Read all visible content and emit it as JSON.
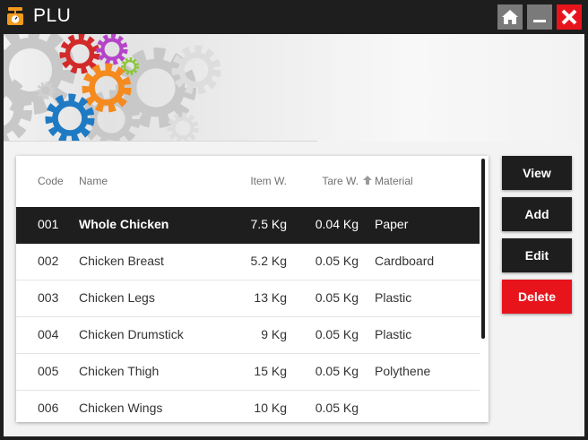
{
  "window": {
    "title": "PLU"
  },
  "colors": {
    "titlebar": "#1e1e1e",
    "accent_red": "#e8141c",
    "button_dark": "#1e1e1e",
    "titlebar_button_gray": "#7a7a7a",
    "selected_row": "#1e1e1e"
  },
  "icons": {
    "app": "scale-icon",
    "home": "home-icon",
    "minimize": "minimize-icon",
    "close": "close-icon"
  },
  "table": {
    "headers": {
      "code": "Code",
      "name": "Name",
      "item_weight": "Item W.",
      "tare_weight": "Tare W.",
      "material": "Material"
    },
    "selected_index": 0,
    "rows": [
      {
        "code": "001",
        "name": "Whole Chicken",
        "item_weight": "7.5 Kg",
        "tare_weight": "0.04 Kg",
        "material": "Paper"
      },
      {
        "code": "002",
        "name": "Chicken Breast",
        "item_weight": "5.2 Kg",
        "tare_weight": "0.05 Kg",
        "material": "Cardboard"
      },
      {
        "code": "003",
        "name": "Chicken Legs",
        "item_weight": "13 Kg",
        "tare_weight": "0.05 Kg",
        "material": "Plastic"
      },
      {
        "code": "004",
        "name": "Chicken Drumstick",
        "item_weight": "9 Kg",
        "tare_weight": "0.05 Kg",
        "material": "Plastic"
      },
      {
        "code": "005",
        "name": "Chicken Thigh",
        "item_weight": "15 Kg",
        "tare_weight": "0.05 Kg",
        "material": "Polythene"
      },
      {
        "code": "006",
        "name": "Chicken Wings",
        "item_weight": "10 Kg",
        "tare_weight": "0.05 Kg",
        "material": ""
      }
    ]
  },
  "actions": {
    "view": "View",
    "add": "Add",
    "edit": "Edit",
    "delete": "Delete"
  }
}
